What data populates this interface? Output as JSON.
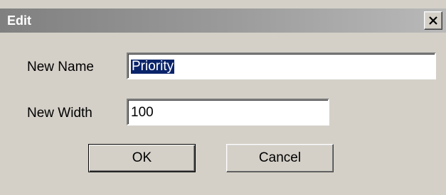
{
  "window": {
    "title": "Edit",
    "close_icon": "close-icon"
  },
  "form": {
    "name_label": "New Name",
    "name_value": "Priority",
    "width_label": "New Width",
    "width_value": "100"
  },
  "buttons": {
    "ok_label": "OK",
    "cancel_label": "Cancel"
  },
  "colors": {
    "dialog_background": "#d4d0c8",
    "title_bar": "#808080",
    "selection": "#0a246a"
  }
}
